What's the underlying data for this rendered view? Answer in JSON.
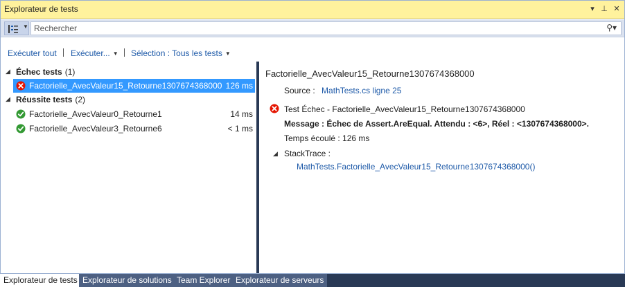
{
  "window": {
    "title": "Explorateur de tests",
    "btn_dropdown": "▾",
    "btn_pin": "⊥",
    "btn_close": "✕"
  },
  "search": {
    "placeholder": "Rechercher",
    "icon": "search-icon"
  },
  "actions": {
    "run_all": "Exécuter tout",
    "run": "Exécuter...",
    "selection": "Sélection : Tous les tests"
  },
  "groups": [
    {
      "label": "Échec tests",
      "count": "(1)",
      "tests": [
        {
          "name": "Factorielle_AvecValeur15_Retourne1307674368000",
          "duration": "126 ms",
          "status": "failed"
        }
      ]
    },
    {
      "label": "Réussite tests",
      "count": "(2)",
      "tests": [
        {
          "name": "Factorielle_AvecValeur0_Retourne1",
          "duration": "14 ms",
          "status": "passed"
        },
        {
          "name": "Factorielle_AvecValeur3_Retourne6",
          "duration": "< 1 ms",
          "status": "passed"
        }
      ]
    }
  ],
  "detail": {
    "title": "Factorielle_AvecValeur15_Retourne1307674368000",
    "source_label": "Source :",
    "source_link": "MathTests.cs ligne 25",
    "status_text": "Test Échec - Factorielle_AvecValeur15_Retourne1307674368000",
    "message": "Message : Échec de Assert.AreEqual. Attendu : <6>, Réel : <1307674368000>.",
    "elapsed": "Temps écoulé : 126 ms",
    "stacktrace_label": "StackTrace :",
    "stacktrace_link": "MathTests.Factorielle_AvecValeur15_Retourne1307674368000()"
  },
  "tabs": [
    {
      "label": "Explorateur de tests",
      "active": true
    },
    {
      "label": "Explorateur de solutions",
      "active": false
    },
    {
      "label": "Team Explorer",
      "active": false
    },
    {
      "label": "Explorateur de serveurs",
      "active": false
    }
  ],
  "colors": {
    "title_bar": "#fff29d",
    "selection": "#3399ff",
    "link": "#1e5aa8",
    "failed": "#e51400",
    "passed": "#339933",
    "frame": "#293955"
  }
}
